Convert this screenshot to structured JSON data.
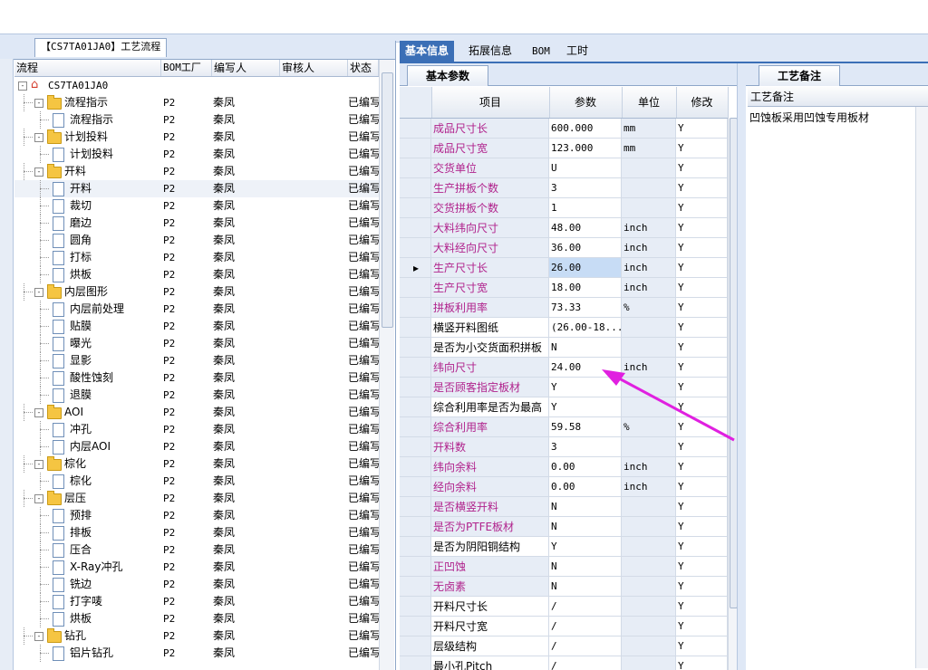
{
  "left_panel": {
    "tab_label": "【CS7TA01JA0】工艺流程",
    "columns": [
      "流程",
      "BOM工厂",
      "编写人",
      "审核人",
      "状态"
    ],
    "rows": [
      {
        "depth": 0,
        "type": "home",
        "toggle": "-",
        "name": "CS7TA01JA0",
        "factory": "",
        "writer": "",
        "reviewer": "",
        "status": ""
      },
      {
        "depth": 1,
        "type": "folder",
        "toggle": "-",
        "name": "流程指示",
        "factory": "P2",
        "writer": "秦凤",
        "reviewer": "",
        "status": "已编写"
      },
      {
        "depth": 2,
        "type": "doc",
        "toggle": "",
        "name": "流程指示",
        "factory": "P2",
        "writer": "秦凤",
        "reviewer": "",
        "status": "已编写"
      },
      {
        "depth": 1,
        "type": "folder",
        "toggle": "-",
        "name": "计划投料",
        "factory": "P2",
        "writer": "秦凤",
        "reviewer": "",
        "status": "已编写"
      },
      {
        "depth": 2,
        "type": "doc",
        "toggle": "",
        "name": "计划投料",
        "factory": "P2",
        "writer": "秦凤",
        "reviewer": "",
        "status": "已编写"
      },
      {
        "depth": 1,
        "type": "folder",
        "toggle": "-",
        "name": "开料",
        "factory": "P2",
        "writer": "秦凤",
        "reviewer": "",
        "status": "已编写"
      },
      {
        "depth": 2,
        "type": "doc",
        "toggle": "",
        "name": "开料",
        "factory": "P2",
        "writer": "秦凤",
        "reviewer": "",
        "status": "已编写",
        "selected": true
      },
      {
        "depth": 2,
        "type": "doc",
        "toggle": "",
        "name": "裁切",
        "factory": "P2",
        "writer": "秦凤",
        "reviewer": "",
        "status": "已编写"
      },
      {
        "depth": 2,
        "type": "doc",
        "toggle": "",
        "name": "磨边",
        "factory": "P2",
        "writer": "秦凤",
        "reviewer": "",
        "status": "已编写"
      },
      {
        "depth": 2,
        "type": "doc",
        "toggle": "",
        "name": "圆角",
        "factory": "P2",
        "writer": "秦凤",
        "reviewer": "",
        "status": "已编写"
      },
      {
        "depth": 2,
        "type": "doc",
        "toggle": "",
        "name": "打标",
        "factory": "P2",
        "writer": "秦凤",
        "reviewer": "",
        "status": "已编写"
      },
      {
        "depth": 2,
        "type": "doc",
        "toggle": "",
        "name": "烘板",
        "factory": "P2",
        "writer": "秦凤",
        "reviewer": "",
        "status": "已编写"
      },
      {
        "depth": 1,
        "type": "folder",
        "toggle": "-",
        "name": "内层图形",
        "factory": "P2",
        "writer": "秦凤",
        "reviewer": "",
        "status": "已编写"
      },
      {
        "depth": 2,
        "type": "doc",
        "toggle": "",
        "name": "内层前处理",
        "factory": "P2",
        "writer": "秦凤",
        "reviewer": "",
        "status": "已编写"
      },
      {
        "depth": 2,
        "type": "doc",
        "toggle": "",
        "name": "贴膜",
        "factory": "P2",
        "writer": "秦凤",
        "reviewer": "",
        "status": "已编写"
      },
      {
        "depth": 2,
        "type": "doc",
        "toggle": "",
        "name": "曝光",
        "factory": "P2",
        "writer": "秦凤",
        "reviewer": "",
        "status": "已编写"
      },
      {
        "depth": 2,
        "type": "doc",
        "toggle": "",
        "name": "显影",
        "factory": "P2",
        "writer": "秦凤",
        "reviewer": "",
        "status": "已编写"
      },
      {
        "depth": 2,
        "type": "doc",
        "toggle": "",
        "name": "酸性蚀刻",
        "factory": "P2",
        "writer": "秦凤",
        "reviewer": "",
        "status": "已编写"
      },
      {
        "depth": 2,
        "type": "doc",
        "toggle": "",
        "name": "退膜",
        "factory": "P2",
        "writer": "秦凤",
        "reviewer": "",
        "status": "已编写"
      },
      {
        "depth": 1,
        "type": "folder",
        "toggle": "-",
        "name": "AOI",
        "factory": "P2",
        "writer": "秦凤",
        "reviewer": "",
        "status": "已编写"
      },
      {
        "depth": 2,
        "type": "doc",
        "toggle": "",
        "name": "冲孔",
        "factory": "P2",
        "writer": "秦凤",
        "reviewer": "",
        "status": "已编写"
      },
      {
        "depth": 2,
        "type": "doc",
        "toggle": "",
        "name": "内层AOI",
        "factory": "P2",
        "writer": "秦凤",
        "reviewer": "",
        "status": "已编写"
      },
      {
        "depth": 1,
        "type": "folder",
        "toggle": "-",
        "name": "棕化",
        "factory": "P2",
        "writer": "秦凤",
        "reviewer": "",
        "status": "已编写"
      },
      {
        "depth": 2,
        "type": "doc",
        "toggle": "",
        "name": "棕化",
        "factory": "P2",
        "writer": "秦凤",
        "reviewer": "",
        "status": "已编写"
      },
      {
        "depth": 1,
        "type": "folder",
        "toggle": "-",
        "name": "层压",
        "factory": "P2",
        "writer": "秦凤",
        "reviewer": "",
        "status": "已编写"
      },
      {
        "depth": 2,
        "type": "doc",
        "toggle": "",
        "name": "预排",
        "factory": "P2",
        "writer": "秦凤",
        "reviewer": "",
        "status": "已编写"
      },
      {
        "depth": 2,
        "type": "doc",
        "toggle": "",
        "name": "排板",
        "factory": "P2",
        "writer": "秦凤",
        "reviewer": "",
        "status": "已编写"
      },
      {
        "depth": 2,
        "type": "doc",
        "toggle": "",
        "name": "压合",
        "factory": "P2",
        "writer": "秦凤",
        "reviewer": "",
        "status": "已编写"
      },
      {
        "depth": 2,
        "type": "doc",
        "toggle": "",
        "name": "X-Ray冲孔",
        "factory": "P2",
        "writer": "秦凤",
        "reviewer": "",
        "status": "已编写"
      },
      {
        "depth": 2,
        "type": "doc",
        "toggle": "",
        "name": "铣边",
        "factory": "P2",
        "writer": "秦凤",
        "reviewer": "",
        "status": "已编写"
      },
      {
        "depth": 2,
        "type": "doc",
        "toggle": "",
        "name": "打字唛",
        "factory": "P2",
        "writer": "秦凤",
        "reviewer": "",
        "status": "已编写"
      },
      {
        "depth": 2,
        "type": "doc",
        "toggle": "",
        "name": "烘板",
        "factory": "P2",
        "writer": "秦凤",
        "reviewer": "",
        "status": "已编写"
      },
      {
        "depth": 1,
        "type": "folder",
        "toggle": "-",
        "name": "钻孔",
        "factory": "P2",
        "writer": "秦凤",
        "reviewer": "",
        "status": "已编写"
      },
      {
        "depth": 2,
        "type": "doc",
        "toggle": "",
        "name": "铝片钻孔",
        "factory": "P2",
        "writer": "秦凤",
        "reviewer": "",
        "status": "已编写"
      }
    ]
  },
  "right_tabs": [
    "基本信息",
    "拓展信息",
    "BOM",
    "工时"
  ],
  "params_panel": {
    "tab_label": "基本参数",
    "columns": [
      "项目",
      "参数",
      "单位",
      "修改"
    ],
    "rows": [
      {
        "item": "成品尺寸长",
        "value": "600.000",
        "unit": "mm",
        "edit": "Y",
        "pink": true
      },
      {
        "item": "成品尺寸宽",
        "value": "123.000",
        "unit": "mm",
        "edit": "Y",
        "pink": true
      },
      {
        "item": "交货单位",
        "value": "U",
        "unit": "",
        "edit": "Y",
        "pink": true
      },
      {
        "item": "生产拼板个数",
        "value": "3",
        "unit": "",
        "edit": "Y",
        "pink": true
      },
      {
        "item": "交货拼板个数",
        "value": "1",
        "unit": "",
        "edit": "Y",
        "pink": true
      },
      {
        "item": "大料纬向尺寸",
        "value": "48.00",
        "unit": "inch",
        "edit": "Y",
        "pink": true
      },
      {
        "item": "大料经向尺寸",
        "value": "36.00",
        "unit": "inch",
        "edit": "Y",
        "pink": true
      },
      {
        "item": "生产尺寸长",
        "value": "26.00",
        "unit": "inch",
        "edit": "Y",
        "pink": true,
        "current": true
      },
      {
        "item": "生产尺寸宽",
        "value": "18.00",
        "unit": "inch",
        "edit": "Y",
        "pink": true
      },
      {
        "item": "拼板利用率",
        "value": "73.33",
        "unit": "%",
        "edit": "Y",
        "pink": true
      },
      {
        "item": "横竖开料图纸",
        "value": "(26.00-18...",
        "unit": "",
        "edit": "Y",
        "pink": false
      },
      {
        "item": "是否为小交货面积拼板",
        "value": "N",
        "unit": "",
        "edit": "Y",
        "pink": false
      },
      {
        "item": "纬向尺寸",
        "value": "24.00",
        "unit": "inch",
        "edit": "Y",
        "pink": true
      },
      {
        "item": "是否顾客指定板材",
        "value": "Y",
        "unit": "",
        "edit": "Y",
        "pink": true
      },
      {
        "item": "综合利用率是否为最高",
        "value": "Y",
        "unit": "",
        "edit": "Y",
        "pink": false
      },
      {
        "item": "综合利用率",
        "value": "59.58",
        "unit": "%",
        "edit": "Y",
        "pink": true
      },
      {
        "item": "开料数",
        "value": "3",
        "unit": "",
        "edit": "Y",
        "pink": true
      },
      {
        "item": "纬向余料",
        "value": "0.00",
        "unit": "inch",
        "edit": "Y",
        "pink": true
      },
      {
        "item": "经向余料",
        "value": "0.00",
        "unit": "inch",
        "edit": "Y",
        "pink": true
      },
      {
        "item": "是否横竖开料",
        "value": "N",
        "unit": "",
        "edit": "Y",
        "pink": true
      },
      {
        "item": "是否为PTFE板材",
        "value": "N",
        "unit": "",
        "edit": "Y",
        "pink": true
      },
      {
        "item": "是否为阴阳铜结构",
        "value": "Y",
        "unit": "",
        "edit": "Y",
        "pink": false
      },
      {
        "item": "正凹蚀",
        "value": "N",
        "unit": "",
        "edit": "Y",
        "pink": true
      },
      {
        "item": "无卤素",
        "value": "N",
        "unit": "",
        "edit": "Y",
        "pink": true
      },
      {
        "item": "开料尺寸长",
        "value": "/",
        "unit": "",
        "edit": "Y",
        "pink": false
      },
      {
        "item": "开料尺寸宽",
        "value": "/",
        "unit": "",
        "edit": "Y",
        "pink": false
      },
      {
        "item": "层级结构",
        "value": "/",
        "unit": "",
        "edit": "Y",
        "pink": false
      },
      {
        "item": "最小孔Pitch",
        "value": "/",
        "unit": "",
        "edit": "Y",
        "pink": false
      }
    ]
  },
  "notes_panel": {
    "tab_label": "工艺备注",
    "header": "工艺备注",
    "text": "凹蚀板采用凹蚀专用板材"
  },
  "colors": {
    "pink_label": "#b0228c",
    "accent": "#3b6fb6",
    "arrow": "#e020e0"
  }
}
